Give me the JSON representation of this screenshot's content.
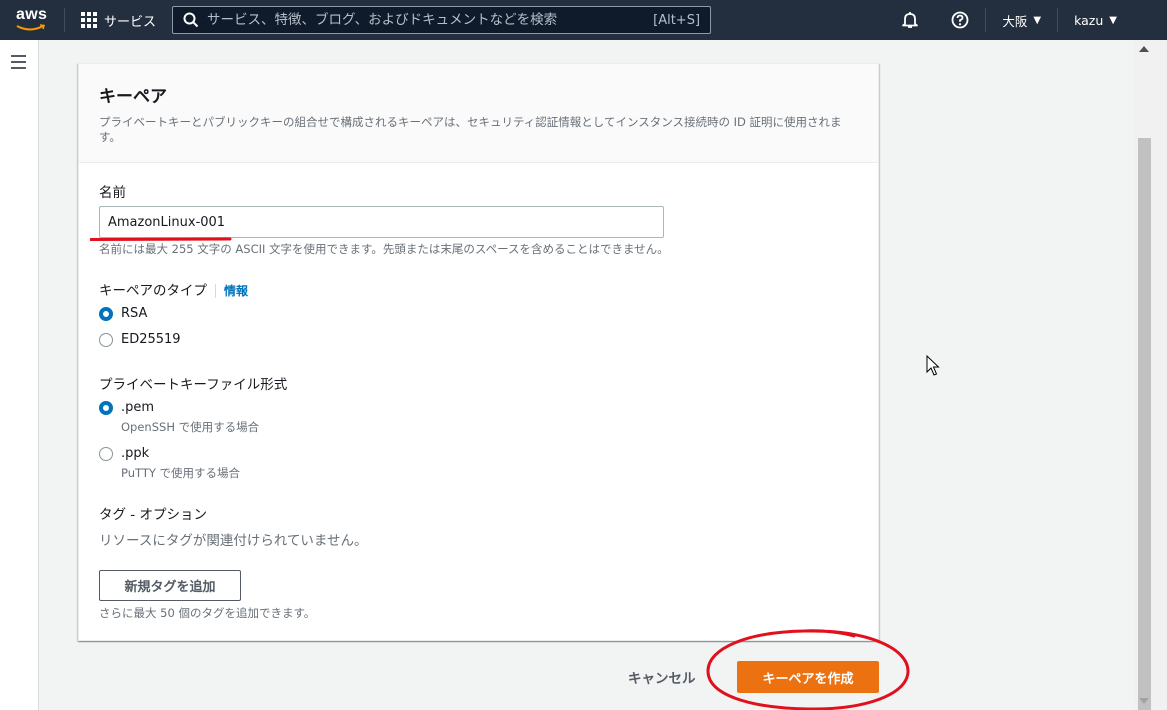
{
  "topnav": {
    "logo_text": "aws",
    "services_label": "サービス",
    "search_placeholder": "サービス、特徴、ブログ、およびドキュメントなどを検索",
    "search_shortcut": "[Alt+S]",
    "icons": [
      "grid-icon",
      "search-icon",
      "bell-icon",
      "help-icon"
    ],
    "region_label": "大阪",
    "user_label": "kazu",
    "caret": "▼"
  },
  "panel": {
    "title": "キーペア",
    "description": "プライベートキーとパブリックキーの組合せで構成されるキーペアは、セキュリティ認証情報としてインスタンス接続時の ID 証明に使用されます。",
    "name_label": "名前",
    "name_value": "AmazonLinux-001",
    "name_hint": "名前には最大 255 文字の ASCII 文字を使用できます。先頭または末尾のスペースを含めることはできません。",
    "keypair_type_label": "キーペアのタイプ",
    "info_link": "情報",
    "keypair_types": [
      {
        "label": "RSA",
        "selected": true
      },
      {
        "label": "ED25519",
        "selected": false
      }
    ],
    "file_format_label": "プライベートキーファイル形式",
    "file_formats": [
      {
        "label": ".pem",
        "sub": "OpenSSH で使用する場合",
        "selected": true
      },
      {
        "label": ".ppk",
        "sub": "PuTTY で使用する場合",
        "selected": false
      }
    ],
    "tags_label": "タグ - オプション",
    "tags_empty": "リソースにタグが関連付けられていません。",
    "add_tag_button": "新規タグを追加",
    "tags_hint": "さらに最大 50 個のタグを追加できます。"
  },
  "actions": {
    "cancel_label": "キャンセル",
    "create_label": "キーペアを作成"
  },
  "colors": {
    "nav_bg": "#232f3e",
    "primary": "#ec7211",
    "link": "#0073bb",
    "annotation": "#e0101c"
  }
}
